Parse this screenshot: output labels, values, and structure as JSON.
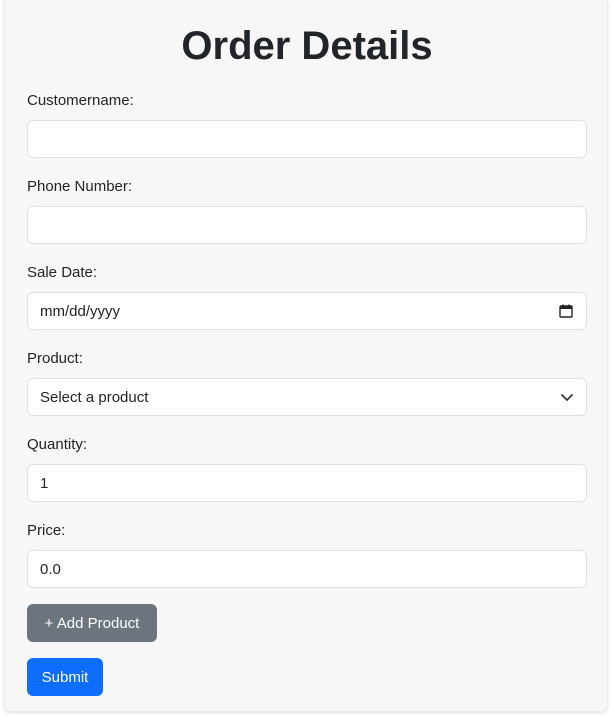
{
  "form": {
    "title": "Order Details",
    "fields": {
      "customername": {
        "label": "Customername:",
        "value": ""
      },
      "phone": {
        "label": "Phone Number:",
        "value": ""
      },
      "sale_date": {
        "label": "Sale Date:",
        "placeholder": "mm/dd/yyyy",
        "icon": "calendar-icon"
      },
      "product": {
        "label": "Product:",
        "selected": "Select a product",
        "icon": "chevron-down-icon"
      },
      "quantity": {
        "label": "Quantity:",
        "value": "1"
      },
      "price": {
        "label": "Price:",
        "value": "0.0"
      }
    },
    "buttons": {
      "add_product": "+ Add Product",
      "submit": "Submit"
    }
  },
  "colors": {
    "card_background": "#f7f7f7",
    "field_border": "#dee2e6",
    "secondary_button": "#6c757d",
    "primary_button": "#0d6efd",
    "text": "#212529"
  }
}
